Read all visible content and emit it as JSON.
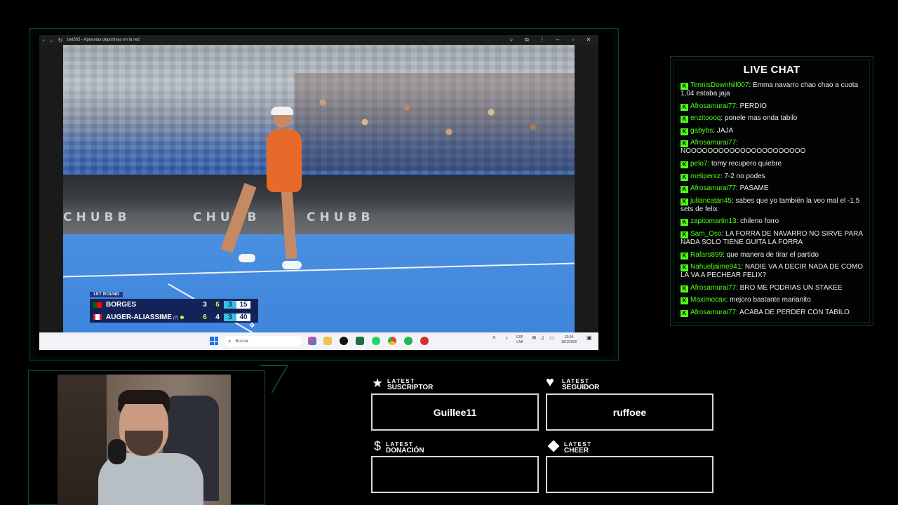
{
  "browser": {
    "tab_title": "bet365 - Apuestas deportivas en la red"
  },
  "video": {
    "sponsor": "CHUBB",
    "scoreboard": {
      "round": "1ST ROUND",
      "players": [
        {
          "name": "BORGES",
          "seed": "",
          "set1": "3",
          "set2": "6",
          "set3": "3",
          "points": "15"
        },
        {
          "name": "AUGER-ALIASSIME",
          "seed": "(7)",
          "set1": "6",
          "set2": "4",
          "set3": "3",
          "points": "40"
        }
      ]
    }
  },
  "taskbar": {
    "search_placeholder": "Buscar",
    "lang_top": "ESP",
    "lang_bottom": "LAA",
    "time": "23:06",
    "date": "18/1/2026"
  },
  "chat": {
    "title": "LIVE CHAT",
    "messages": [
      {
        "user": "TennisDownhill007",
        "text": "Emma navarro chao chao a cuota 1,04 estaba jaja"
      },
      {
        "user": "Afrosamurai77",
        "text": "PERDIO"
      },
      {
        "user": "enzitoooq",
        "text": "ponele mas onda tabilo"
      },
      {
        "user": "gabybs",
        "text": "JAJA"
      },
      {
        "user": "Afrosamurai77",
        "text": "NOOOOOOOOOOOOOOOOOOOOOO"
      },
      {
        "user": "pelo7",
        "text": "tomy recupero quiebre"
      },
      {
        "user": "meliperxz",
        "text": "7-2 no podes"
      },
      {
        "user": "Afrosamurai77",
        "text": "PASAME"
      },
      {
        "user": "juliancatan45",
        "text": "sabes que yo también la veo mal el -1.5 sets de felix"
      },
      {
        "user": "zapitomartin13",
        "text": "chileno forro"
      },
      {
        "user": "Sam_Oso",
        "text": "LA FORRA DE NAVARRO NO SIRVE PARA NADA SOLO TIENE GUITA LA FORRA"
      },
      {
        "user": "Rafars899",
        "text": "que manera de tirar el partido"
      },
      {
        "user": "Nahueljaime941",
        "text": "NADIE VA A DECIR NADA DE COMO LA VA A PECHEAR FELIX?"
      },
      {
        "user": "Afrosamurai77",
        "text": "BRO ME PODRIAS UN STAKEE"
      },
      {
        "user": "Maximocax",
        "text": "mejoro bastante marianito"
      },
      {
        "user": "Afrosamurai77",
        "text": "ACABA DE PERDER CON TABILO"
      }
    ]
  },
  "alerts": {
    "subscriber": {
      "small": "LATEST",
      "big": "SUSCRIPTOR",
      "value": "Guillee11",
      "icon": "star-icon"
    },
    "follower": {
      "small": "LATEST",
      "big": "SEGUIDOR",
      "value": "ruffoee",
      "icon": "heart-icon"
    },
    "donation": {
      "small": "LATEST",
      "big": "DONACIÓN",
      "value": "",
      "icon": "dollar-icon"
    },
    "cheer": {
      "small": "LATEST",
      "big": "CHEER",
      "value": "",
      "icon": "diamond-icon"
    }
  },
  "colors": {
    "accent": "#53fc18",
    "frame": "#0f4a3c",
    "scoreboard_bg": "#13235a"
  }
}
